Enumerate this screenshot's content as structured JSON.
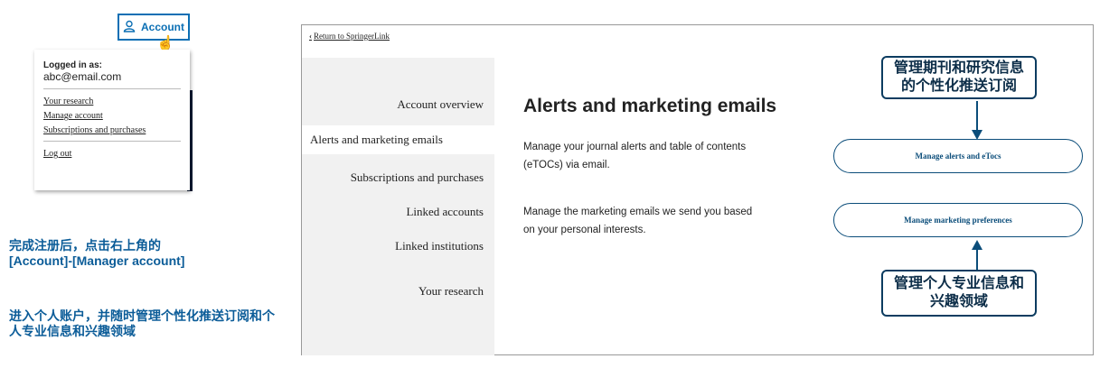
{
  "account_button": {
    "label": "Account",
    "icon": "user-icon"
  },
  "dropdown": {
    "logged_in_label": "Logged in as:",
    "email": "abc@email.com",
    "links": [
      "Your research",
      "Manage account",
      "Subscriptions and purchases"
    ],
    "logout": "Log out"
  },
  "left_notes": {
    "note1_line1": "完成注册后，点击右上角的",
    "note1_line2": "[Account]-[Manager account]",
    "note2": "进入个人账户，并随时管理个性化推送订阅和个人专业信息和兴趣领域"
  },
  "panel": {
    "return_link": "Return to SpringerLink",
    "sidebar": [
      "Account overview",
      "Alerts and marketing emails",
      "Subscriptions and purchases",
      "Linked accounts",
      "Linked institutions",
      "Your research"
    ],
    "title": "Alerts and marketing emails",
    "desc1_line1": "Manage your journal alerts and table of contents",
    "desc1_line2": "(eTOCs) via email.",
    "desc2_line1": "Manage the marketing emails we send you based",
    "desc2_line2": "on your personal interests.",
    "btn_alerts": "Manage alerts and eTocs",
    "btn_marketing": "Manage marketing preferences"
  },
  "callouts": {
    "top_line1": "管理期刊和研究信息",
    "top_line2": "的个性化推送订阅",
    "bottom_line1": "管理个人专业信息和",
    "bottom_line2": "兴趣领域"
  },
  "colors": {
    "accent": "#0b6fb4",
    "callout_border": "#0c3c60",
    "sidebar_bg": "#f1f1f1"
  }
}
